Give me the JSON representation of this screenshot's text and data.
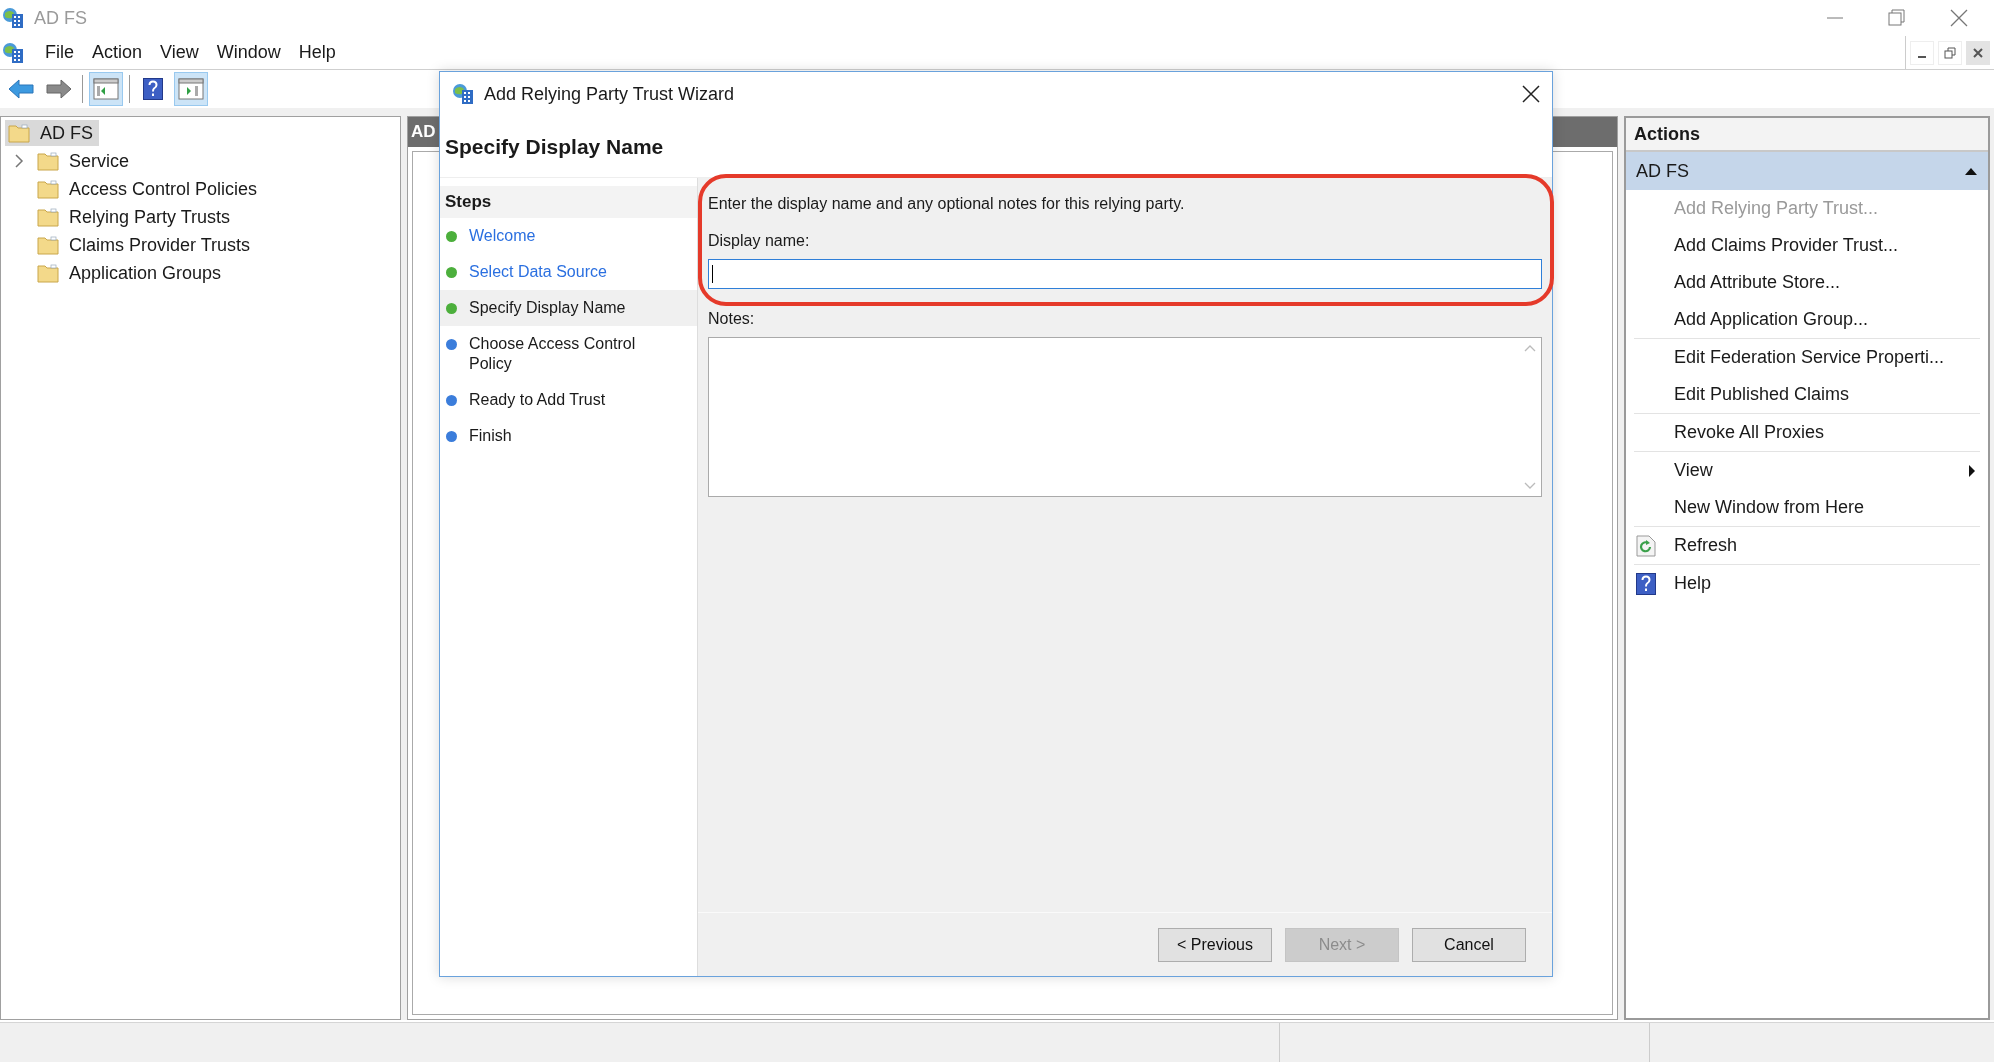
{
  "window": {
    "title": "AD FS"
  },
  "menu": [
    {
      "label": "File"
    },
    {
      "label": "Action"
    },
    {
      "label": "View"
    },
    {
      "label": "Window"
    },
    {
      "label": "Help"
    }
  ],
  "toolbar": [
    {
      "pressed": false
    },
    {
      "pressed": false
    },
    {
      "pressed": true
    },
    {
      "pressed": false
    },
    {
      "pressed": true
    }
  ],
  "tree": {
    "label": "AD FS",
    "selected": true,
    "children": [
      {
        "label": "Service",
        "expandable": true
      },
      {
        "label": "Access Control Policies",
        "expandable": false
      },
      {
        "label": "Relying Party Trusts",
        "expandable": false
      },
      {
        "label": "Claims Provider Trusts",
        "expandable": false
      },
      {
        "label": "Application Groups",
        "expandable": false
      }
    ]
  },
  "middle_panel": {
    "header": "AD"
  },
  "actions": {
    "title": "Actions",
    "section": {
      "label": "AD FS",
      "expanded": true
    },
    "groups": [
      [
        {
          "label": "Add Relying Party Trust...",
          "kind": "plain",
          "disabled": true
        },
        {
          "label": "Add Claims Provider Trust...",
          "kind": "plain",
          "disabled": false
        },
        {
          "label": "Add Attribute Store...",
          "kind": "plain",
          "disabled": false
        },
        {
          "label": "Add Application Group...",
          "kind": "plain",
          "disabled": false
        }
      ],
      [
        {
          "label": "Edit Federation Service Properti...",
          "kind": "plain",
          "disabled": false
        },
        {
          "label": "Edit Published Claims",
          "kind": "plain",
          "disabled": false
        }
      ],
      [
        {
          "label": "Revoke All Proxies",
          "kind": "plain",
          "disabled": false
        }
      ],
      [
        {
          "label": "View",
          "kind": "submenu",
          "disabled": false
        },
        {
          "label": "New Window from Here",
          "kind": "plain",
          "disabled": false
        }
      ],
      [
        {
          "label": "Refresh",
          "kind": "refresh",
          "disabled": false
        }
      ],
      [
        {
          "label": "Help",
          "kind": "help",
          "disabled": false
        }
      ]
    ]
  },
  "dialog": {
    "title": "Add Relying Party Trust Wizard",
    "heading": "Specify Display Name",
    "steps_title": "Steps",
    "steps": [
      {
        "label": "Welcome",
        "color": "#4caf3c",
        "link": true,
        "selected": false
      },
      {
        "label": "Select Data Source",
        "color": "#4caf3c",
        "link": true,
        "selected": false
      },
      {
        "label": "Specify Display Name",
        "color": "#4caf3c",
        "link": false,
        "selected": true
      },
      {
        "label": "Choose Access Control Policy",
        "color": "#3b7ddb",
        "link": false,
        "selected": false
      },
      {
        "label": "Ready to Add Trust",
        "color": "#3b7ddb",
        "link": false,
        "selected": false
      },
      {
        "label": "Finish",
        "color": "#3b7ddb",
        "link": false,
        "selected": false
      }
    ],
    "instruction": "Enter the display name and any optional notes for this relying party.",
    "display_name_label": "Display name:",
    "display_name_focused": true,
    "notes_label": "Notes:",
    "highlighted": true,
    "buttons": [
      {
        "label": "< Previous",
        "disabled": false
      },
      {
        "label": "Next >",
        "disabled": true
      },
      {
        "label": "Cancel",
        "disabled": false
      }
    ]
  }
}
